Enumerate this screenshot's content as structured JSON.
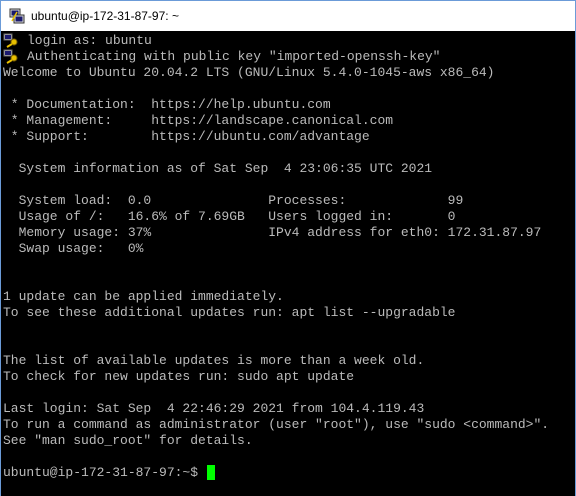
{
  "window": {
    "title": "ubuntu@ip-172-31-87-97: ~"
  },
  "terminal": {
    "login_line": "login as: ubuntu",
    "auth_line": "Authenticating with public key \"imported-openssh-key\"",
    "welcome_line": "Welcome to Ubuntu 20.04.2 LTS (GNU/Linux 5.4.0-1045-aws x86_64)",
    "doc_line": " * Documentation:  https://help.ubuntu.com",
    "mgmt_line": " * Management:     https://landscape.canonical.com",
    "support_line": " * Support:        https://ubuntu.com/advantage",
    "sysinfo_line": "  System information as of Sat Sep  4 23:06:35 UTC 2021",
    "stats_line_1": "  System load:  0.0               Processes:             99",
    "stats_line_2": "  Usage of /:   16.6% of 7.69GB   Users logged in:       0",
    "stats_line_3": "  Memory usage: 37%               IPv4 address for eth0: 172.31.87.97",
    "stats_line_4": "  Swap usage:   0%",
    "update_line_1": "1 update can be applied immediately.",
    "update_line_2": "To see these additional updates run: apt list --upgradable",
    "list_line_1": "The list of available updates is more than a week old.",
    "list_line_2": "To check for new updates run: sudo apt update",
    "last_login_line": "Last login: Sat Sep  4 22:46:29 2021 from 104.4.119.43",
    "admin_line_1": "To run a command as administrator (user \"root\"), use \"sudo <command>\".",
    "admin_line_2": "See \"man sudo_root\" for details.",
    "prompt": "ubuntu@ip-172-31-87-97:~$ "
  },
  "colors": {
    "terminal_background": "#000000",
    "terminal_text": "#bbbbbb",
    "cursor": "#00ff00"
  }
}
